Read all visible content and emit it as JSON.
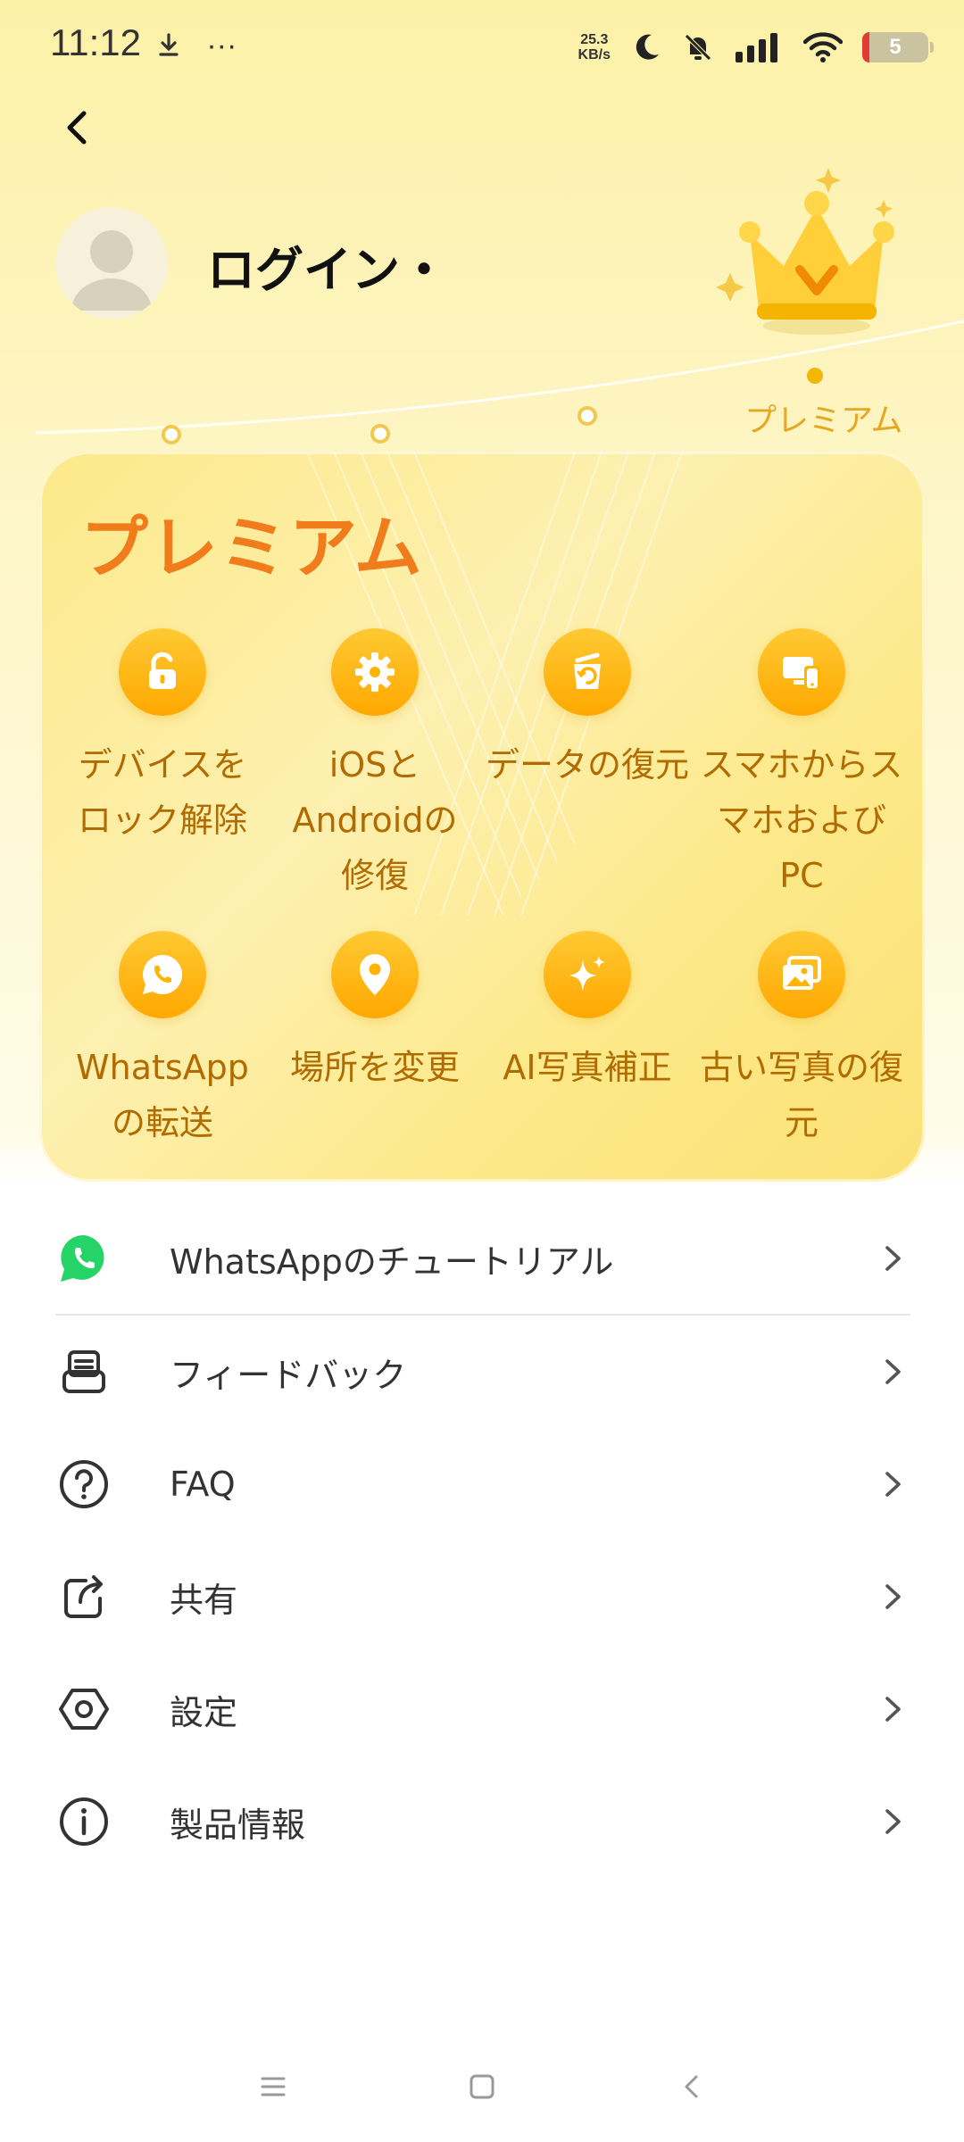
{
  "status_bar": {
    "time": "11:12",
    "more": "···",
    "net_speed_value": "25.3",
    "net_speed_unit": "KB/s",
    "battery": "5"
  },
  "header": {
    "login_text": "ログイン・",
    "premium_level_label": "プレミアム"
  },
  "card": {
    "title": "プレミアム",
    "features": [
      {
        "label": "デバイスをロック解除",
        "icon": "unlock-icon"
      },
      {
        "label": "iOSとAndroidの修復",
        "icon": "gear-icon"
      },
      {
        "label": "データの復元",
        "icon": "restore-bin-icon"
      },
      {
        "label": "スマホからスマホおよびPC",
        "icon": "devices-icon"
      },
      {
        "label": "WhatsAppの転送",
        "icon": "whatsapp-icon"
      },
      {
        "label": "場所を変更",
        "icon": "location-pin-icon"
      },
      {
        "label": "AI写真補正",
        "icon": "sparkle-icon"
      },
      {
        "label": "古い写真の復元",
        "icon": "photo-icon"
      }
    ]
  },
  "menu": {
    "items": [
      {
        "label": "WhatsAppのチュートリアル",
        "icon": "whatsapp-icon"
      },
      {
        "label": "フィードバック",
        "icon": "feedback-icon"
      },
      {
        "label": "FAQ",
        "icon": "question-icon"
      },
      {
        "label": "共有",
        "icon": "share-icon"
      },
      {
        "label": "設定",
        "icon": "settings-hex-icon"
      },
      {
        "label": "製品情報",
        "icon": "info-icon"
      }
    ]
  },
  "colors": {
    "accent_orange": "#f07c1c",
    "feature_text": "#b26b00",
    "feature_icon": "#ffb400",
    "whatsapp_green": "#25d366"
  }
}
